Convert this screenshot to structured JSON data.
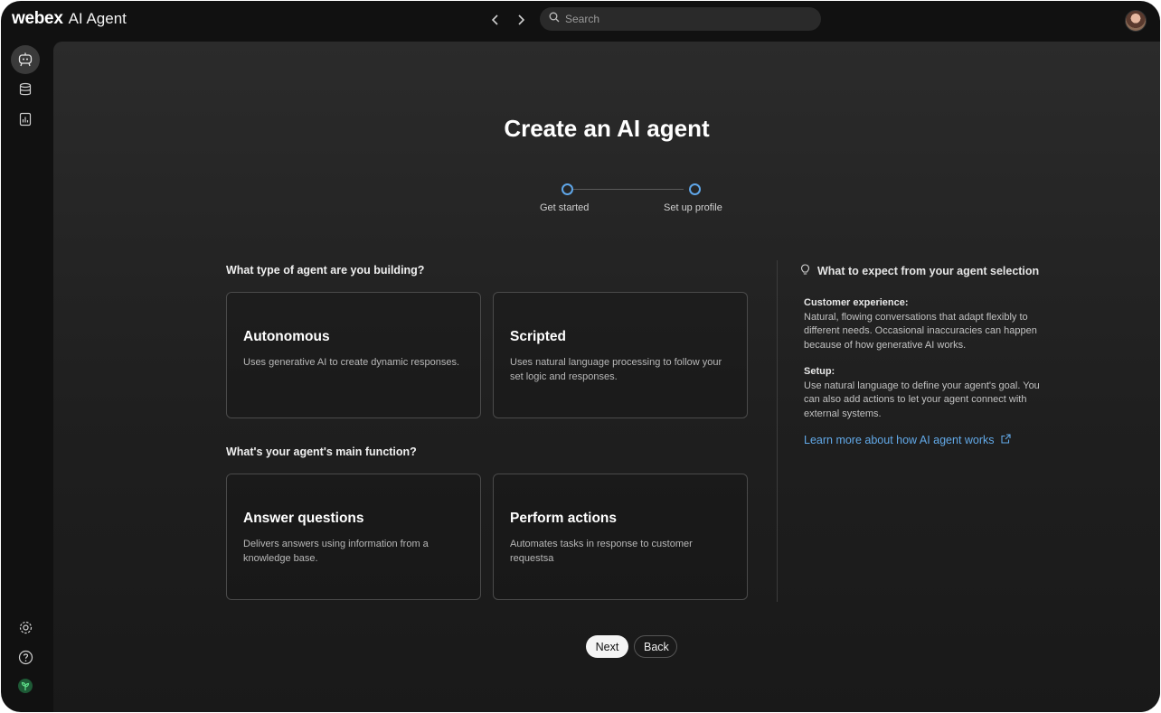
{
  "app": {
    "logo": "webex",
    "product": "AI Agent"
  },
  "search": {
    "placeholder": "Search"
  },
  "page": {
    "title": "Create an AI agent"
  },
  "stepper": {
    "steps": [
      {
        "label": "Get started"
      },
      {
        "label": "Set up profile"
      }
    ]
  },
  "agent_type": {
    "question": "What type of agent are you building?",
    "options": [
      {
        "title": "Autonomous",
        "desc": "Uses generative AI to create dynamic responses."
      },
      {
        "title": "Scripted",
        "desc": "Uses natural language processing to follow your set logic and responses."
      }
    ]
  },
  "agent_function": {
    "question": "What's your agent's main function?",
    "options": [
      {
        "title": "Answer questions",
        "desc": "Delivers answers using information from a knowledge base."
      },
      {
        "title": "Perform actions",
        "desc": "Automates tasks in response to customer requestsa"
      }
    ]
  },
  "info": {
    "heading": "What to expect from your agent selection",
    "blocks": [
      {
        "label": "Customer experience:",
        "text": "Natural, flowing conversations that adapt flexibly to different needs. Occasional inaccuracies can happen because of how generative AI works."
      },
      {
        "label": "Setup:",
        "text": "Use natural language to define your agent's goal. You can also add actions to let your agent connect with external systems."
      }
    ],
    "link": "Learn more about how AI agent works"
  },
  "buttons": {
    "next": "Next",
    "back": "Back"
  },
  "colors": {
    "accent": "#5fa6e8",
    "link": "#62a9e8",
    "background": "#111111"
  },
  "icons": {
    "rail_top": [
      "ai-agent-icon",
      "database-icon",
      "report-icon"
    ],
    "rail_bottom": [
      "gear-icon",
      "help-icon",
      "plant-icon"
    ]
  }
}
